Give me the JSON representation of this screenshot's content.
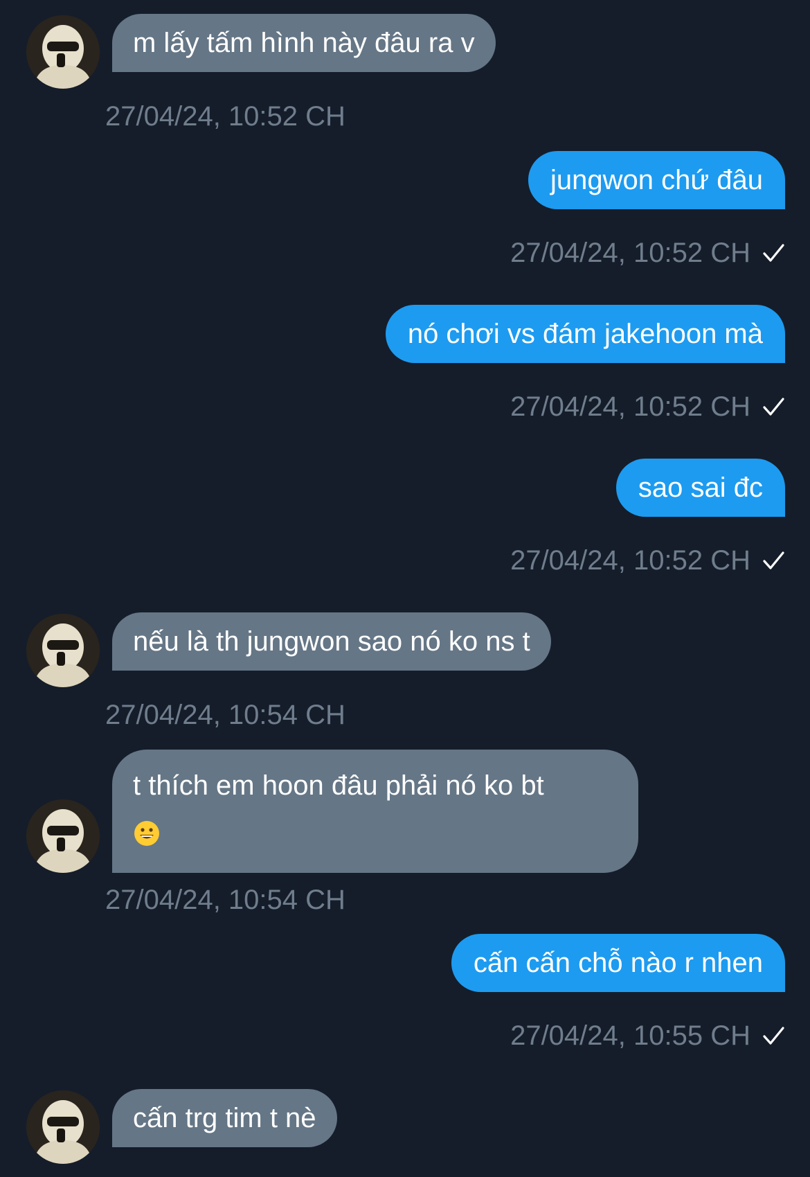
{
  "messages": [
    {
      "side": "in",
      "text": "m lấy tấm hình này đâu ra v",
      "time": "27/04/24, 10:52 CH"
    },
    {
      "side": "out",
      "text": "jungwon chứ đâu",
      "time": "27/04/24, 10:52 CH"
    },
    {
      "side": "out",
      "text": "nó chơi vs đám jakehoon mà",
      "time": "27/04/24, 10:52 CH"
    },
    {
      "side": "out",
      "text": "sao sai đc",
      "time": "27/04/24, 10:52 CH"
    },
    {
      "side": "in",
      "text": "nếu là th jungwon sao nó ko ns t",
      "time": "27/04/24, 10:54 CH"
    },
    {
      "side": "in",
      "text": "t thích em hoon đâu phải nó ko bt",
      "emoji": "grinning-face-icon",
      "time": "27/04/24, 10:54 CH"
    },
    {
      "side": "out",
      "text": "cấn cấn chỗ nào r nhen",
      "time": "27/04/24, 10:55 CH"
    },
    {
      "side": "in",
      "text": "cấn trg tim t nè",
      "time": ""
    }
  ],
  "colors": {
    "background": "#151d2a",
    "incoming_bubble": "#657686",
    "outgoing_bubble": "#1d9bf0",
    "timestamp": "#6f7d8c"
  },
  "icons": {
    "sent": "check-icon",
    "avatar": "avatar"
  }
}
